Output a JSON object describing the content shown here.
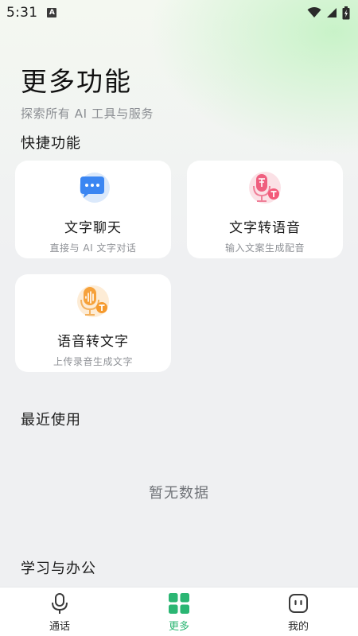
{
  "status_bar": {
    "time": "5:31",
    "notification_letter": "A"
  },
  "header": {
    "title": "更多功能",
    "subtitle": "探索所有 AI 工具与服务"
  },
  "sections": {
    "quick": "快捷功能",
    "recent": "最近使用",
    "study": "学习与办公"
  },
  "cards": [
    {
      "title": "文字聊天",
      "desc": "直接与 AI 文字对话",
      "icon": "chat-bubble-icon"
    },
    {
      "title": "文字转语音",
      "desc": "输入文案生成配音",
      "icon": "pink-microphone-icon"
    },
    {
      "title": "语音转文字",
      "desc": "上传录音生成文字",
      "icon": "orange-microphone-icon"
    }
  ],
  "recent_empty": "暂无数据",
  "bottom_nav": [
    {
      "label": "通话",
      "icon": "microphone-icon",
      "active": false
    },
    {
      "label": "更多",
      "icon": "grid-icon",
      "active": true
    },
    {
      "label": "我的",
      "icon": "robot-face-icon",
      "active": false
    }
  ],
  "colors": {
    "accent": "#2bb673",
    "background": "#eff0f2",
    "card": "#ffffff"
  }
}
